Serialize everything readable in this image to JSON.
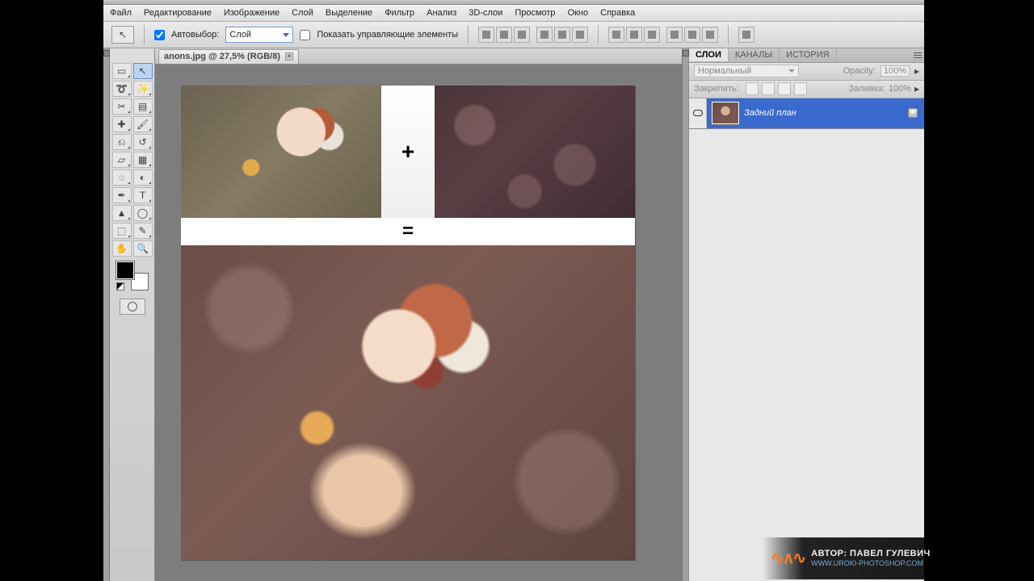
{
  "menu": {
    "file": "Файл",
    "edit": "Редактирование",
    "image": "Изображение",
    "layer": "Слой",
    "select": "Выделение",
    "filter": "Фильтр",
    "analysis": "Анализ",
    "threed": "3D-слои",
    "view": "Просмотр",
    "window": "Окно",
    "help": "Справка"
  },
  "options": {
    "autoselect_label": "Автовыбор:",
    "autoselect_value": "Слой",
    "show_transform_label": "Показать управляющие элементы"
  },
  "document": {
    "tab_title": "anons.jpg @ 27,5% (RGB/8)",
    "plus": "+",
    "equals": "="
  },
  "panels": {
    "tabs": {
      "layers": "СЛОИ",
      "channels": "КАНАЛЫ",
      "history": "ИСТОРИЯ"
    },
    "blend_mode": "Нормальный",
    "opacity_label": "Opacity:",
    "opacity_value": "100%",
    "lock_label": "Закрепить:",
    "fill_label": "Заливка:",
    "fill_value": "100%",
    "layer0": "Задний план"
  },
  "watermark": {
    "author_label": "АВТОР: ПАВЕЛ ГУЛЕВИЧ",
    "url": "WWW.UROKI-PHOTOSHOP.COM"
  }
}
